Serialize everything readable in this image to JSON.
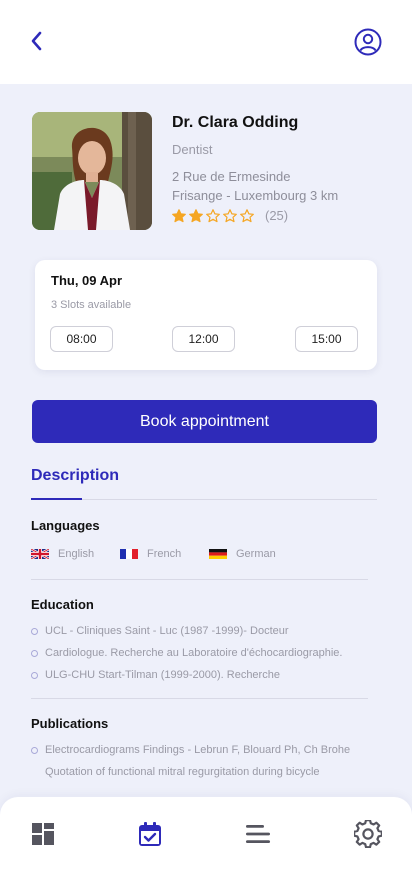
{
  "header": {
    "back_icon": "chevron-left-icon",
    "profile_icon": "user-circle-icon"
  },
  "doctor": {
    "name": "Dr. Clara Odding",
    "specialty": "Dentist",
    "address_line1": "2 Rue de Ermesinde",
    "address_line2": "Frisange - Luxembourg 3 km",
    "rating": 2,
    "rating_max": 5,
    "review_count": "(25)"
  },
  "slots": {
    "date": "Thu, 09 Apr",
    "available": "3 Slots available",
    "times": [
      "08:00",
      "12:00",
      "15:00"
    ]
  },
  "book_button": "Book appointment",
  "tabs": {
    "description": "Description"
  },
  "languages": {
    "title": "Languages",
    "items": [
      {
        "label": "English",
        "flag": "uk-flag-icon"
      },
      {
        "label": "French",
        "flag": "france-flag-icon"
      },
      {
        "label": "German",
        "flag": "germany-flag-icon"
      }
    ]
  },
  "education": {
    "title": "Education",
    "items": [
      "UCL - Cliniques Saint - Luc (1987 -1999)- Docteur",
      "Cardiologue. Recherche au Laboratoire d'échocardiographie.",
      "ULG-CHU Start-Tilman (1999-2000). Recherche"
    ]
  },
  "publications": {
    "title": "Publications",
    "items": [
      "Electrocardiograms Findings - Lebrun F, Blouard Ph, Ch Brohe",
      "Quotation of functional mitral regurgitation during bicycle"
    ]
  },
  "bottom_nav": {
    "items": [
      "dashboard-icon",
      "calendar-check-icon",
      "menu-lines-icon",
      "settings-gear-icon"
    ],
    "active_index": 1
  },
  "colors": {
    "accent": "#2e2ab9",
    "star": "#f5a623",
    "background": "#eef0fa"
  }
}
